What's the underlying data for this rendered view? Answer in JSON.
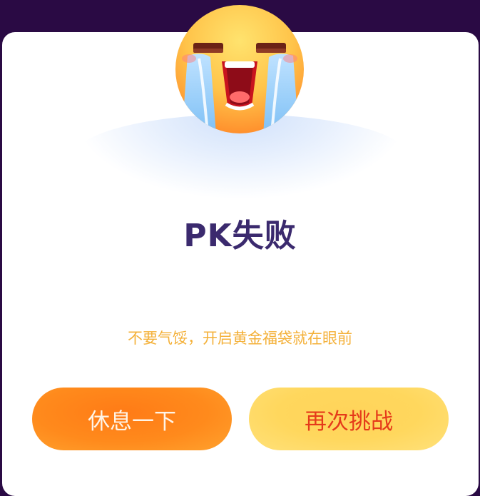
{
  "dialog": {
    "title": "PK失败",
    "message": "不要气馁，开启黄金福袋就在眼前",
    "emoji": "crying-face-icon"
  },
  "actions": {
    "rest_label": "休息一下",
    "retry_label": "再次挑战"
  },
  "colors": {
    "backdrop": "#2a0a44",
    "title": "#3b2a6e",
    "message": "#f4b13a",
    "rest_button": "#ff8a1c",
    "retry_button": "#ffd75d",
    "retry_text": "#e53a1a"
  }
}
